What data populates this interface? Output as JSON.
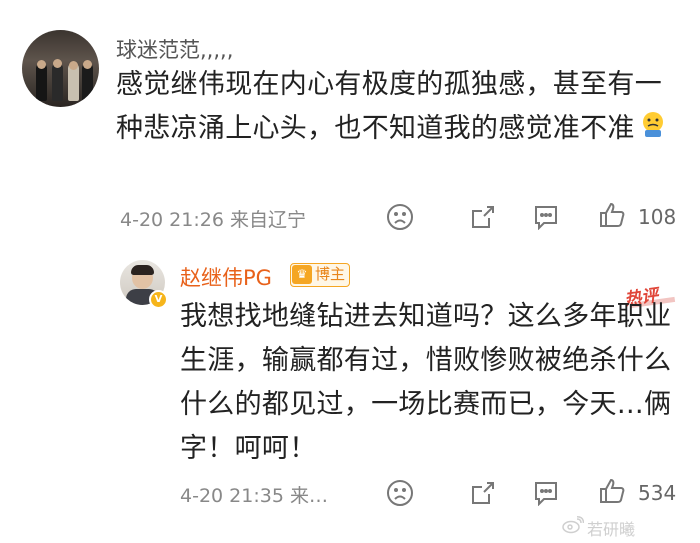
{
  "comment1": {
    "username": "球迷范范,,,,,",
    "text": "感觉继伟现在内心有极度的孤独感，甚至有一种悲凉涌上心头，也不知道我的感觉准不准",
    "meta": "4-20 21:26  来自辽宁",
    "like_count": "108",
    "emoji_icon": "worried-emoji-icon"
  },
  "reply": {
    "username": "赵继伟PG",
    "badge_label": "博主",
    "hot_label": "热评",
    "text": "我想找地缝钻进去知道吗？这么多年职业生涯，输赢都有过，惜败惨败被绝杀什么什么的都见过，一场比赛而已，今天…俩字！呵呵！",
    "meta": "4-20 21:35  来…",
    "like_count": "534"
  },
  "watermark": {
    "text": "若研曦"
  },
  "colors": {
    "username_reply": "#e8611a",
    "hot": "#e0473a",
    "badge": "#f5a623"
  }
}
